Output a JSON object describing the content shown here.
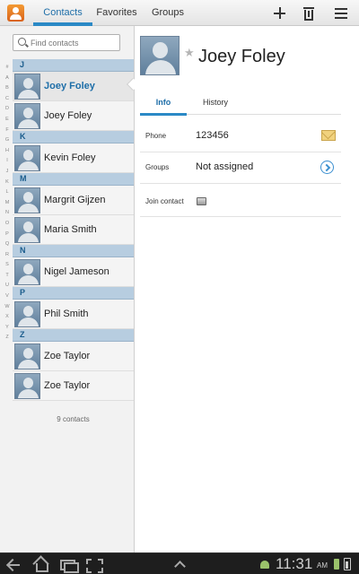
{
  "tabs": [
    {
      "label": "Contacts",
      "selected": true
    },
    {
      "label": "Favorites",
      "selected": false
    },
    {
      "label": "Groups",
      "selected": false
    }
  ],
  "actions": [
    "add-icon",
    "trash-icon",
    "menu-icon"
  ],
  "search": {
    "placeholder": "Find contacts"
  },
  "alpha_index": [
    "#",
    "A",
    "B",
    "C",
    "D",
    "E",
    "F",
    "G",
    "H",
    "I",
    "J",
    "K",
    "L",
    "M",
    "N",
    "O",
    "P",
    "Q",
    "R",
    "S",
    "T",
    "U",
    "V",
    "W",
    "X",
    "Y",
    "Z"
  ],
  "contact_sections": [
    {
      "letter": "J",
      "contacts": [
        "Joey Foley",
        "Joey Foley"
      ]
    },
    {
      "letter": "K",
      "contacts": [
        "Kevin Foley"
      ]
    },
    {
      "letter": "M",
      "contacts": [
        "Margrit Gijzen",
        "Maria Smith"
      ]
    },
    {
      "letter": "N",
      "contacts": [
        "Nigel Jameson"
      ]
    },
    {
      "letter": "P",
      "contacts": [
        "Phil Smith"
      ]
    },
    {
      "letter": "Z",
      "contacts": [
        "Zoe Taylor",
        "Zoe Taylor"
      ]
    }
  ],
  "selected_contact": "Joey Foley",
  "contact_count": "9 contacts",
  "detail": {
    "name": "Joey Foley",
    "tabs": {
      "info": "Info",
      "history": "History"
    },
    "phone_label": "Phone",
    "phone_value": "123456",
    "groups_label": "Groups",
    "groups_value": "Not assigned",
    "join_label": "Join contact"
  },
  "status_bar": {
    "time": "11:31",
    "ampm": "AM"
  },
  "colors": {
    "accent": "#2b89c6",
    "section_header": "#b7cde0",
    "selected_text": "#1e6ea8"
  }
}
